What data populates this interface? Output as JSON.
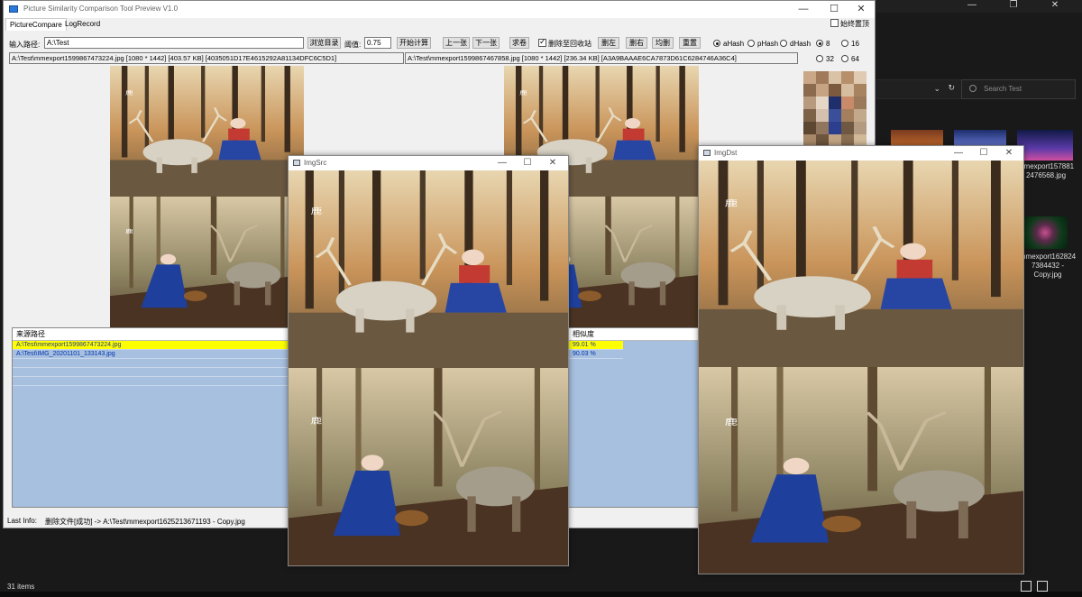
{
  "main_window": {
    "title": "Picture Similarity Comparison Tool Preview V1.0",
    "minimize": "—",
    "maximize": "☐",
    "close": "✕",
    "tabs": [
      {
        "label": "PictureCompare"
      },
      {
        "label": "LogRecord"
      }
    ],
    "always_on_top": {
      "label": "始终置顶",
      "checked": false
    }
  },
  "toolbar": {
    "path_label": "输入路径:",
    "path_value": "A:\\Test",
    "browse_button": "浏览目录",
    "threshold_label": "阈值:",
    "threshold_value": "0.75",
    "start_button": "开始计算",
    "prev_button": "上一张",
    "next_button": "下一张",
    "refresh_button": "求卷",
    "delete_to_recycle": {
      "label": "删除至回收站",
      "checked": true
    },
    "delete_left_button": "删左",
    "delete_right_button": "删右",
    "both_delete_button": "均删",
    "reset_button": "重置",
    "hash_options": [
      {
        "label": "aHash",
        "selected": true
      },
      {
        "label": "pHash",
        "selected": false
      },
      {
        "label": "dHash",
        "selected": false
      }
    ],
    "size_options": [
      {
        "label": "8",
        "selected": true
      },
      {
        "label": "16",
        "selected": false
      },
      {
        "label": "32",
        "selected": false
      },
      {
        "label": "64",
        "selected": false
      }
    ]
  },
  "left_info": "A:\\Test\\mmexport1599867473224.jpg [1080 * 1442] [403.57 KB] [4035051D17E4615292A81134DFC6C5D1]",
  "right_info": "A:\\Test\\mmexport1599867467858.jpg [1080 * 1442] [236.34 KB] [A3A9BAAAE6CA7873D61C6284746A36C4]",
  "source_list": {
    "header": "来源路径",
    "rows": [
      {
        "path": "A:\\Test\\mmexport1599867473224.jpg",
        "selected": true
      },
      {
        "path": "A:\\Test\\IMG_20201101_133143.jpg",
        "selected": false
      }
    ]
  },
  "similarity_list": {
    "header": "相似度",
    "rows": [
      {
        "value": "99.01 %",
        "selected": true
      },
      {
        "value": "90.03 %",
        "selected": false
      }
    ]
  },
  "last_info": {
    "label": "Last Info:",
    "text": "删除文件[成功] -> A:\\Test\\mmexport1625213671193 - Copy.jpg"
  },
  "img_src_window": {
    "title": "ImgSrc",
    "minimize": "—",
    "maximize": "☐",
    "close": "✕"
  },
  "img_dst_window": {
    "title": "ImgDst",
    "minimize": "—",
    "maximize": "☐",
    "close": "✕"
  },
  "explorer": {
    "search_placeholder": "Search Test",
    "items": [
      {
        "label": "mmexport157881 2476568.jpg"
      },
      {
        "label": "mmexport162824 7384432 - Copy.jpg"
      }
    ],
    "status_text": "31 items"
  },
  "colors": {
    "selected_row": "#ffff00",
    "list_bg": "#a7c0df",
    "list_text": "#0033aa"
  }
}
